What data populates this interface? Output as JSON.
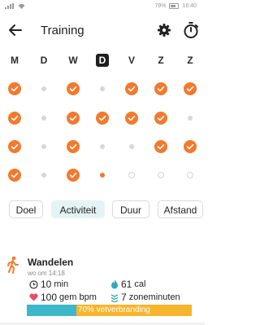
{
  "status_bar": {
    "battery": "79%",
    "time": "16:40"
  },
  "header": {
    "title": "Training"
  },
  "days": [
    {
      "label": "M",
      "current": false
    },
    {
      "label": "D",
      "current": false
    },
    {
      "label": "W",
      "current": false
    },
    {
      "label": "D",
      "current": true
    },
    {
      "label": "V",
      "current": false
    },
    {
      "label": "Z",
      "current": false
    },
    {
      "label": "Z",
      "current": false
    }
  ],
  "week_grid": [
    [
      "check",
      "dot",
      "check",
      "dot",
      "check",
      "check",
      "check"
    ],
    [
      "check",
      "dot",
      "check",
      "check",
      "check",
      "check",
      "dot"
    ],
    [
      "check",
      "dot",
      "check",
      "dot",
      "dot",
      "check",
      "check"
    ],
    [
      "check",
      "dot",
      "check",
      "today",
      "ring",
      "ring",
      "ring"
    ]
  ],
  "tabs": [
    {
      "label": "Doel",
      "active": false
    },
    {
      "label": "Activiteit",
      "active": true
    },
    {
      "label": "Duur",
      "active": false
    },
    {
      "label": "Afstand",
      "active": false
    }
  ],
  "activity": {
    "title": "Wandelen",
    "subtitle": "wo om 14:18",
    "duration_value": "10",
    "duration_unit": "min",
    "calories_value": "61",
    "calories_unit": "cal",
    "heart_value": "100",
    "heart_unit": "gem bpm",
    "zone_value": "7",
    "zone_unit": "zoneminuten",
    "fat_burn_label": "70% vetverbranding",
    "cardio_fraction": 0.3
  },
  "colors": {
    "accent": "#f27a2e",
    "active_tab_bg": "#e4f3f4",
    "zone_cardio": "#3db8c9",
    "zone_fatburn": "#f6b52c"
  }
}
